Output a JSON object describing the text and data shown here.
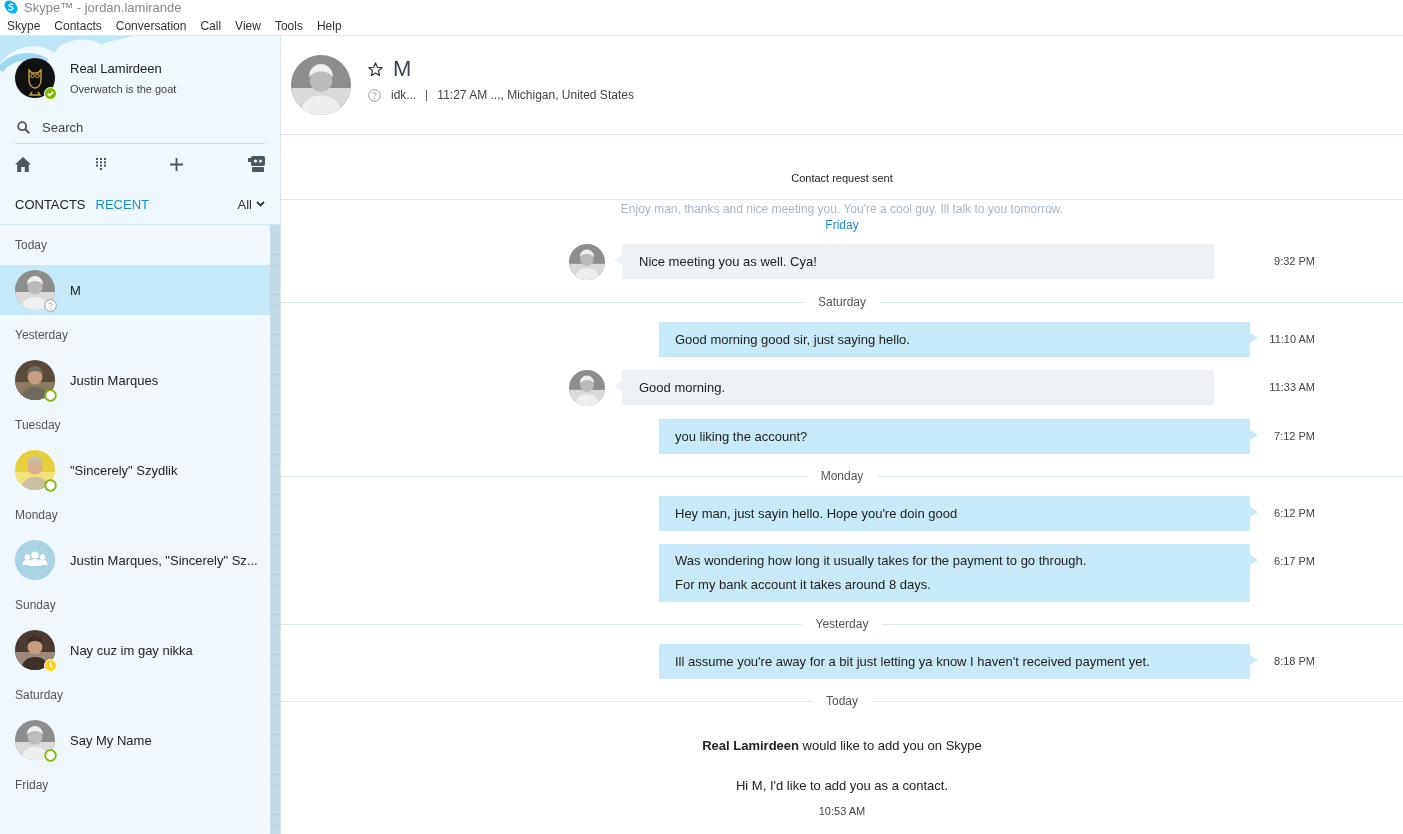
{
  "window": {
    "title": "Skype™ - jordan.lamirande"
  },
  "menu": [
    "Skype",
    "Contacts",
    "Conversation",
    "Call",
    "View",
    "Tools",
    "Help"
  ],
  "profile": {
    "name": "Real Lamirdeen",
    "mood": "Overwatch is the goat",
    "badge": {
      "kind": "checked"
    }
  },
  "search": {
    "placeholder": "Search"
  },
  "tabs": [
    {
      "label": "CONTACTS",
      "selected": false
    },
    {
      "label": "RECENT",
      "selected": true
    }
  ],
  "filter": {
    "label": "All"
  },
  "recent": [
    {
      "day": "Today",
      "contacts": [
        {
          "name": "M",
          "kind": "person",
          "badge": {
            "kind": "unknown"
          },
          "selected": true
        }
      ]
    },
    {
      "day": "Yesterday",
      "contacts": [
        {
          "name": "Justin Marques",
          "kind": "person",
          "badge": {
            "kind": "online"
          },
          "selected": false
        }
      ]
    },
    {
      "day": "Tuesday",
      "contacts": [
        {
          "name": "\"Sincerely\" Szydlik",
          "kind": "person",
          "badge": {
            "kind": "online"
          },
          "selected": false
        }
      ]
    },
    {
      "day": "Monday",
      "contacts": [
        {
          "name": "Justin Marques, \"Sincerely\" Sz...",
          "kind": "group",
          "selected": false
        }
      ]
    },
    {
      "day": "Sunday",
      "contacts": [
        {
          "name": "Nay cuz im gay nikka",
          "kind": "person",
          "badge": {
            "kind": "away"
          },
          "selected": false
        }
      ]
    },
    {
      "day": "Saturday",
      "contacts": [
        {
          "name": "Say My Name",
          "kind": "person",
          "badge": {
            "kind": "online"
          },
          "selected": false
        }
      ]
    },
    {
      "day": "Friday"
    }
  ],
  "conversation": {
    "name": "M",
    "favorite": false,
    "badge": {
      "kind": "unknown"
    },
    "mood": "idk...",
    "location": "11:27 AM ..., Michigan, United States"
  },
  "notice": "Contact request sent",
  "messages": [
    {
      "kind": "faded",
      "text": "Enjoy man, thanks and nice meeting you. You're a cool guy. Ill talk to you tomorrow."
    },
    {
      "kind": "floating_date",
      "text": "Friday"
    },
    {
      "kind": "incoming",
      "lines": [
        "Nice meeting you as well. Cya!"
      ],
      "time": "9:32 PM"
    },
    {
      "kind": "date",
      "text": "Saturday"
    },
    {
      "kind": "outgoing",
      "lines": [
        "Good morning good sir, just saying hello."
      ],
      "time": "11:10 AM"
    },
    {
      "kind": "incoming",
      "lines": [
        "Good morning."
      ],
      "time": "11:33 AM"
    },
    {
      "kind": "outgoing",
      "lines": [
        "you liking the account?"
      ],
      "time": "7:12 PM"
    },
    {
      "kind": "date",
      "text": "Monday"
    },
    {
      "kind": "outgoing",
      "lines": [
        "Hey man, just sayin hello. Hope you're doin good"
      ],
      "time": "6:12 PM"
    },
    {
      "kind": "outgoing",
      "lines": [
        "Was wondering how long it usually takes for the payment to go through.",
        "For my bank account it takes around 8 days."
      ],
      "time": "6:17 PM"
    },
    {
      "kind": "date",
      "text": "Yesterday"
    },
    {
      "kind": "outgoing",
      "lines": [
        "Ill assume you're away for a bit just letting ya know I haven't received payment yet."
      ],
      "time": "8:18 PM"
    },
    {
      "kind": "date",
      "text": "Today"
    },
    {
      "kind": "request",
      "title": "**Real Lamirdeen** would like to add you on Skype",
      "message": "Hi M, I'd like to add you as a contact.",
      "time": "10:53 AM"
    }
  ]
}
